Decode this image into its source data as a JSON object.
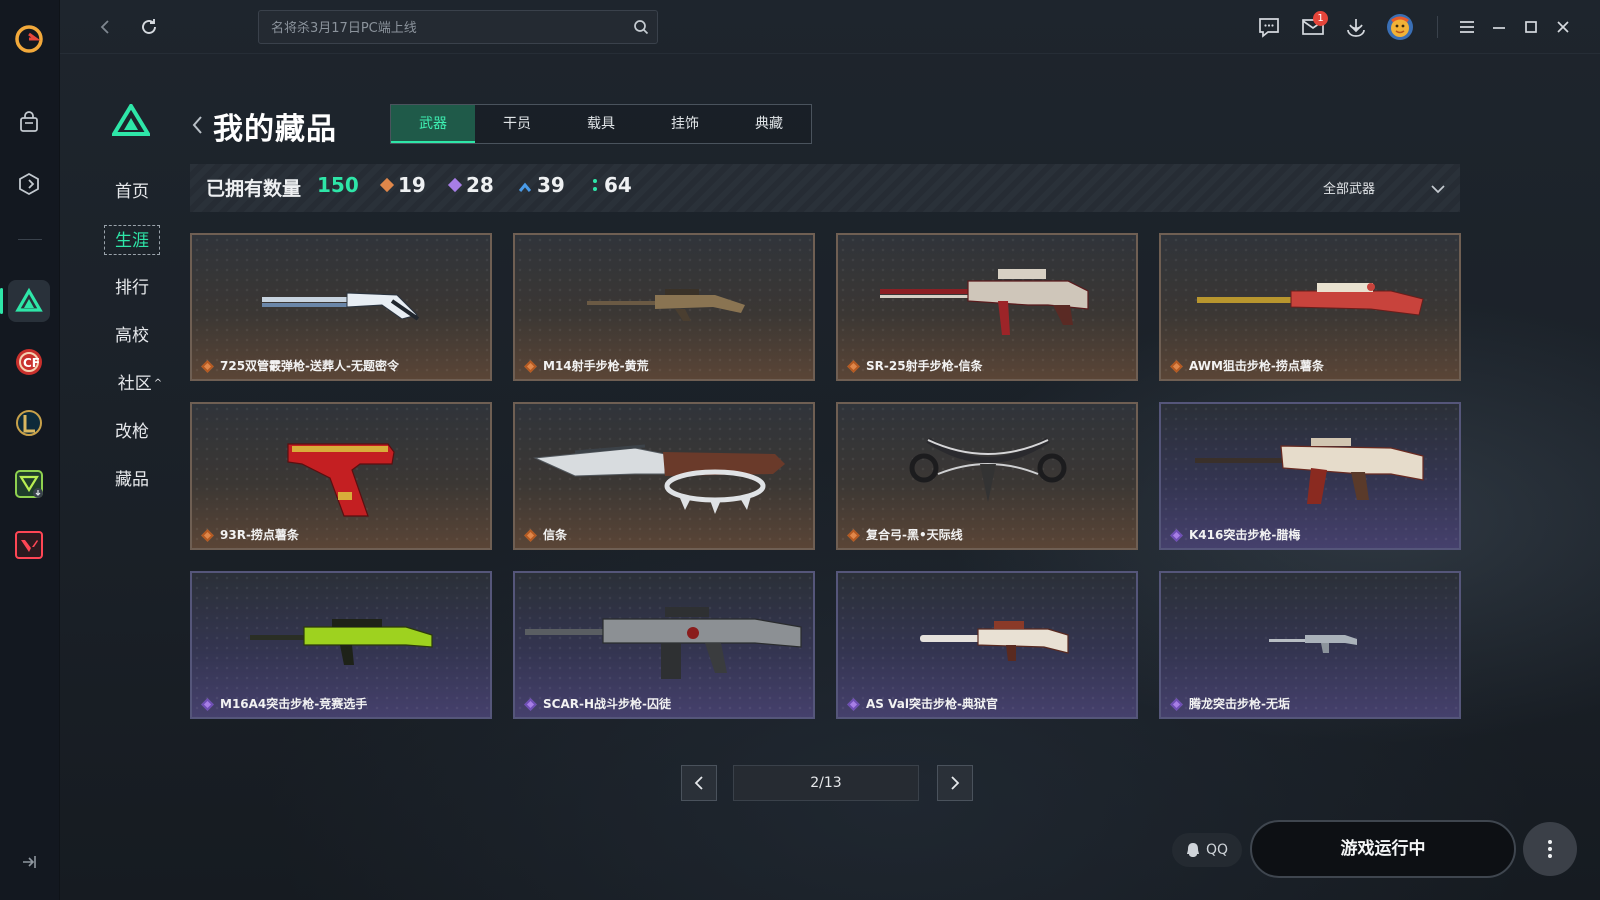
{
  "search": {
    "placeholder": "名将杀3月17日PC端上线"
  },
  "notifications": {
    "mail_badge": "1"
  },
  "sidebar_nav": {
    "items": [
      {
        "label": "首页"
      },
      {
        "label": "生涯"
      },
      {
        "label": "排行"
      },
      {
        "label": "高校"
      },
      {
        "label": "社区"
      },
      {
        "label": "改枪"
      },
      {
        "label": "藏品"
      }
    ],
    "active_index": 1,
    "community_caret": "^"
  },
  "header": {
    "title": "我的藏品"
  },
  "tabs": [
    {
      "label": "武器"
    },
    {
      "label": "干员"
    },
    {
      "label": "载具"
    },
    {
      "label": "挂饰"
    },
    {
      "label": "典藏"
    }
  ],
  "stats": {
    "owned_label": "已拥有数量",
    "owned_count": "150",
    "orange_count": "19",
    "purple_count": "28",
    "blue_count": "39",
    "green_count": "64",
    "colors": {
      "orange": "#e0874a",
      "purple": "#a77ee6",
      "blue": "#4a9be8",
      "green": "#2ee6a8"
    }
  },
  "filter": {
    "selected": "全部武器"
  },
  "items": [
    {
      "name": "725双管霰弹枪-送葬人-无题密令",
      "rarity": "orange"
    },
    {
      "name": "M14射手步枪-黄荒",
      "rarity": "orange"
    },
    {
      "name": "SR-25射手步枪-信条",
      "rarity": "orange"
    },
    {
      "name": "AWM狙击步枪-捞点薯条",
      "rarity": "orange"
    },
    {
      "name": "93R-捞点薯条",
      "rarity": "orange"
    },
    {
      "name": "信条",
      "rarity": "orange"
    },
    {
      "name": "复合弓-黑•天际线",
      "rarity": "orange"
    },
    {
      "name": "K416突击步枪-腊梅",
      "rarity": "purple"
    },
    {
      "name": "M16A4突击步枪-竞赛选手",
      "rarity": "purple"
    },
    {
      "name": "SCAR-H战斗步枪-囚徒",
      "rarity": "purple"
    },
    {
      "name": "AS Val突击步枪-典狱官",
      "rarity": "purple"
    },
    {
      "name": "腾龙突击步枪-无垢",
      "rarity": "purple"
    }
  ],
  "pagination": {
    "display": "2/13",
    "current_page": 2,
    "total_pages": 13
  },
  "bottom": {
    "qq_label": "QQ",
    "run_label": "游戏运行中"
  }
}
